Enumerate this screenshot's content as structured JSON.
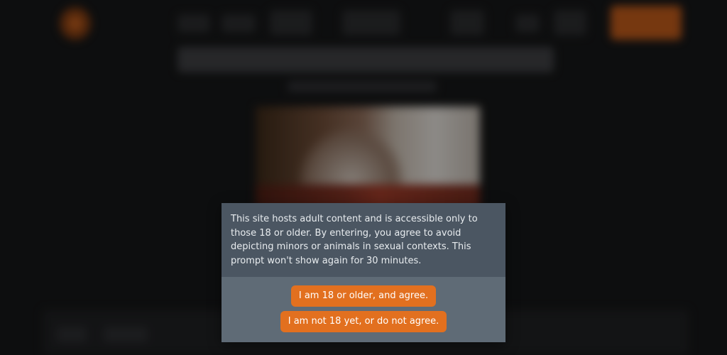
{
  "age_gate": {
    "message": "This site hosts adult content and is accessible only to those 18 or older. By entering, you agree to avoid depicting minors or animals in sexual contexts. This prompt won't show again for 30 minutes.",
    "agree_label": "I am 18 or older, and agree.",
    "decline_label": "I am not 18 yet, or do not agree."
  },
  "colors": {
    "modal_body": "#4b5662",
    "modal_footer": "#5f6b76",
    "button": "#e2701f",
    "page_background": "#151617"
  }
}
